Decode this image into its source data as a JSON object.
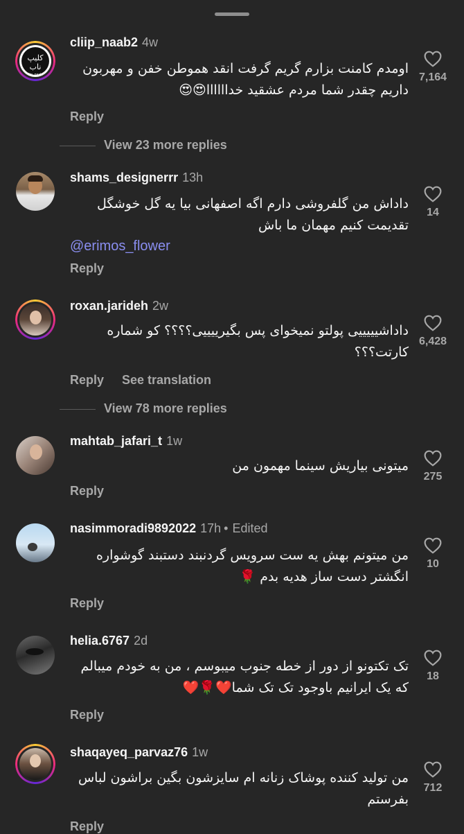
{
  "reply_label": "Reply",
  "comments": [
    {
      "username": "cliip_naab2",
      "time": "4w",
      "avatar_text": "کلیپ ناب",
      "avatar_subtext": "cliip_naab2",
      "text": "اومدم کامنت بزارم گریم گرفت انقد هموطن خفن و مهربون داریم چقدر شما مردم عشقید خداااااا😍😍",
      "likes": "7,164",
      "reply": "Reply",
      "view_more": "View 23 more replies"
    },
    {
      "username": "shams_designerrr",
      "time": "13h",
      "text": "داداش من گلفروشی دارم اگه اصفهانی بیا یه گل خوشگل تقدیمت کنیم مهمان ما باش",
      "mention": "@erimos_flower",
      "likes": "14",
      "reply": "Reply"
    },
    {
      "username": "roxan.jarideh",
      "time": "2w",
      "text": "داداشیییییی پولتو نمیخوای پس بگیرییییی؟؟؟؟ کو شماره کارتت؟؟؟",
      "likes": "6,428",
      "reply": "Reply",
      "translate": "See translation",
      "view_more": "View 78 more replies"
    },
    {
      "username": "mahtab_jafari_t",
      "time": "1w",
      "text": "میتونی بیاریش سینما مهمون من",
      "likes": "275",
      "reply": "Reply"
    },
    {
      "username": "nasimmoradi9892022",
      "time": "17h",
      "edited": "Edited",
      "text": "من میتونم بهش یه ست سرویس گردنبند دستبند گوشواره انگشتر دست ساز هدیه بدم 🌹",
      "likes": "10",
      "reply": "Reply"
    },
    {
      "username": "helia.6767",
      "time": "2d",
      "text": "تک تکتونو از دور از خطه جنوب میبوسم ، من به خودم میبالم که یک ایرانیم باوجود تک تک شما❤️🌹❤️",
      "likes": "18",
      "reply": "Reply"
    },
    {
      "username": "shaqayeq_parvaz76",
      "time": "1w",
      "text": "من تولید کننده پوشاک زنانه ام سایزشون بگین براشون لباس بفرستم",
      "likes": "712",
      "reply": "Reply"
    }
  ],
  "colors": {
    "background": "#262626",
    "secondary_text": "#a8a8a8",
    "mention": "#8a8ef0"
  }
}
